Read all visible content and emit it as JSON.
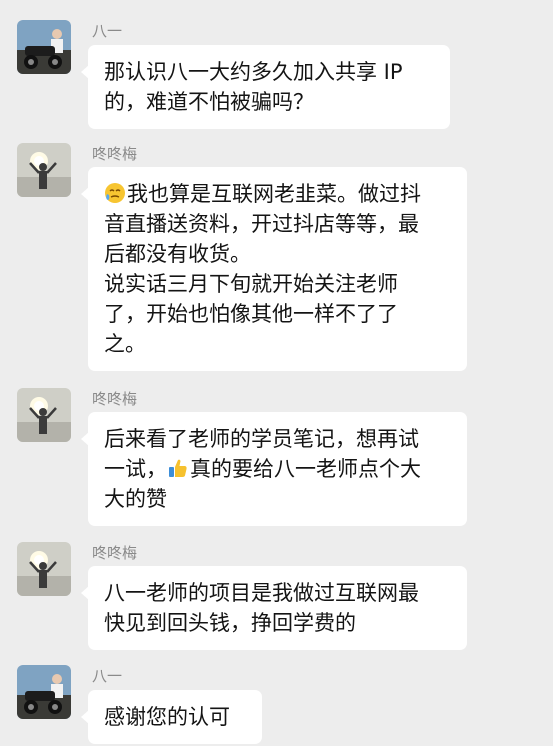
{
  "messages": [
    {
      "sender": "八一",
      "avatar_icon": "man-on-motorcycle-avatar",
      "lines": [
        "那认识八一大约多久加入共享 IP",
        "的，难道不怕被骗吗？"
      ]
    },
    {
      "sender": "咚咚梅",
      "avatar_icon": "woman-arms-raised-sunset-avatar",
      "emoji_icon": "crying-face-emoji",
      "lines": [
        "我也算是互联网老韭菜。做过抖",
        "音直播送资料，开过抖店等等，最",
        "后都没有收货。",
        "说实话三月下旬就开始关注老师",
        "了，开始也怕像其他一样不了了",
        "之。"
      ]
    },
    {
      "sender": "咚咚梅",
      "avatar_icon": "woman-arms-raised-sunset-avatar",
      "emoji_icon": "thumbs-up-emoji",
      "lines": [
        "后来看了老师的学员笔记，想再试",
        "一试，",
        "真的要给八一老师点个大",
        "大的赞"
      ]
    },
    {
      "sender": "咚咚梅",
      "avatar_icon": "woman-arms-raised-sunset-avatar",
      "lines": [
        "八一老师的项目是我做过互联网最",
        "快见到回头钱，挣回学费的"
      ]
    },
    {
      "sender": "八一",
      "avatar_icon": "man-on-motorcycle-avatar",
      "lines": [
        "感谢您的认可"
      ]
    }
  ],
  "colors": {
    "background": "#ededed",
    "bubble": "#ffffff",
    "sender_name": "#8a8a8a",
    "text": "#141414"
  }
}
